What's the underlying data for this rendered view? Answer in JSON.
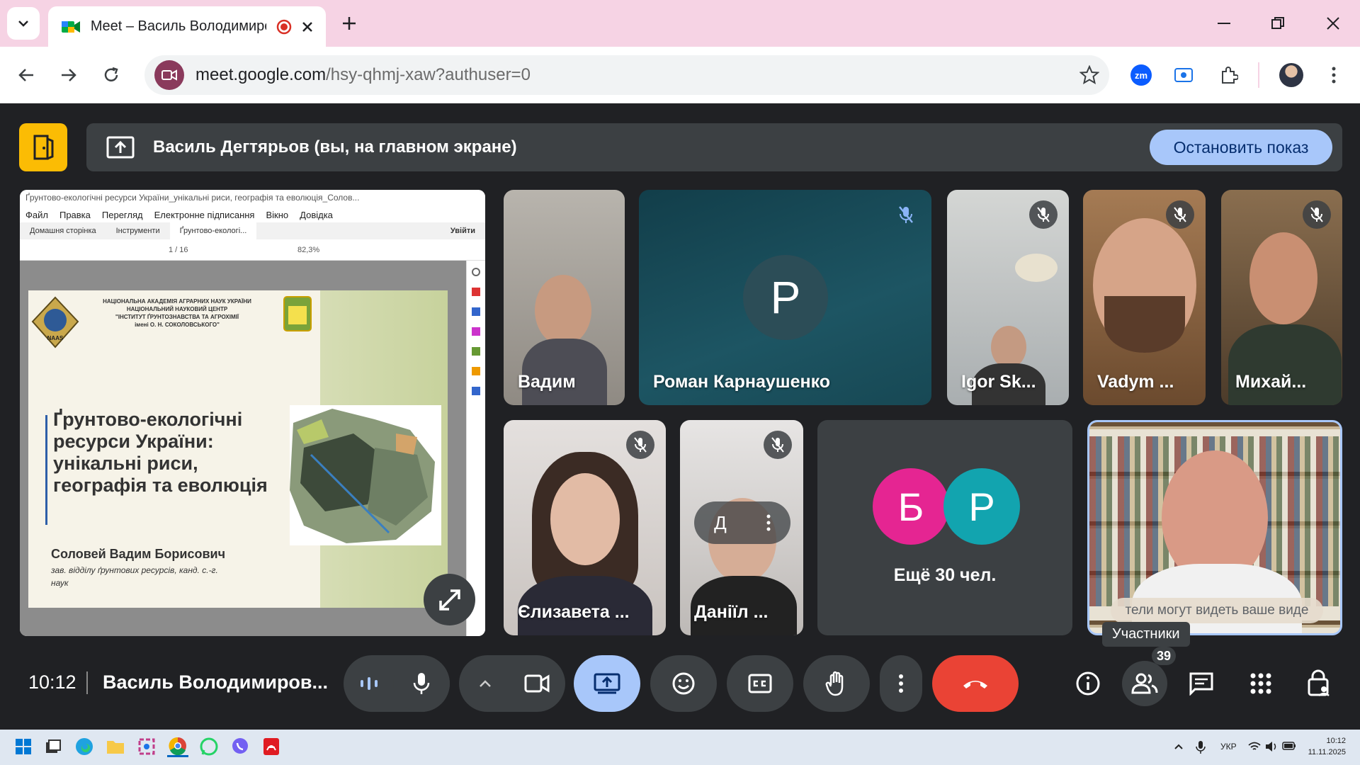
{
  "browser": {
    "tab_title": "Meet – Василь Володимирович",
    "url_domain": "meet.google.com",
    "url_path": "/hsy-qhmj-xaw?authuser=0"
  },
  "presenting": {
    "banner_text": "Василь Дегтярьов (вы, на главном экране)",
    "stop_label": "Остановить показ"
  },
  "pdf": {
    "window_title": "Ґрунтово-екологічні ресурси України_унікальні риси, географія та еволюція_Солов...",
    "menu": [
      "Файл",
      "Правка",
      "Перегляд",
      "Електронне підписання",
      "Вікно",
      "Довідка"
    ],
    "tabs": [
      "Домашня сторінка",
      "Інструменти",
      "Ґрунтово-екологі..."
    ],
    "signin": "Увійти",
    "page_indicator": "1 / 16",
    "zoom": "82,3%",
    "slide": {
      "institution": "НАЦІОНАЛЬНА АКАДЕМІЯ АГРАРНИХ НАУК УКРАЇНИ\nНАЦІОНАЛЬНИЙ НАУКОВИЙ ЦЕНТР\n\"ІНСТИТУТ ҐРУНТОЗНАВСТВА ТА АГРОХІМІЇ\nімені О. Н. СОКОЛОВСЬКОГО\"",
      "logo_text": "NAAS",
      "title": "Ґрунтово-екологічні ресурси України: унікальні риси, географія та еволюція",
      "author": "Соловей Вадим Борисович",
      "affiliation": "зав. відділу ґрунтових ресурсів, канд. с.-г. наук"
    }
  },
  "participants": [
    {
      "name": "Вадим",
      "muted": false
    },
    {
      "name": "Роман Карнаушенко",
      "initial": "Р",
      "muted": true
    },
    {
      "name": "Igor Sk...",
      "muted": true
    },
    {
      "name": "Vadym ...",
      "muted": true
    },
    {
      "name": "Михай...",
      "muted": true
    },
    {
      "name": "Єлизавета ...",
      "muted": true
    },
    {
      "name": "Даніїл ...",
      "muted": true,
      "hover_initial": "Д"
    },
    {
      "name": "self",
      "caption": "тели могут видеть ваше виде"
    }
  ],
  "others": {
    "avatars": [
      "Б",
      "Р"
    ],
    "label": "Ещё 30 чел."
  },
  "bottom": {
    "time": "10:12",
    "meeting_name": "Василь Володимиров...",
    "participants_tooltip": "Участники",
    "participants_count": "39"
  },
  "taskbar": {
    "lang": "УКР",
    "time": "10:12",
    "date": "11.11.2025"
  },
  "colors": {
    "accent": "#a8c7fa",
    "end_call": "#ea4335",
    "present_active": "#a8c7fa",
    "avatar_b": "#e52592",
    "avatar_r": "#12a4af"
  }
}
